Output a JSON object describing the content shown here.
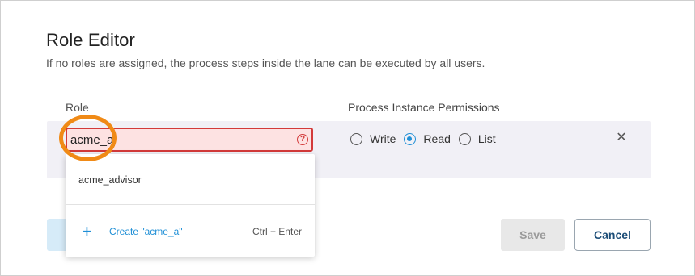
{
  "dialog": {
    "title": "Role Editor",
    "subtitle": "If no roles are assigned, the process steps inside the lane can be executed by all users."
  },
  "table": {
    "role_header": "Role",
    "permissions_header": "Process Instance Permissions"
  },
  "role_input": {
    "value": "acme_a",
    "error": true
  },
  "permissions": {
    "options": [
      {
        "label": "Write",
        "checked": false
      },
      {
        "label": "Read",
        "checked": true
      },
      {
        "label": "List",
        "checked": false
      }
    ]
  },
  "dropdown": {
    "suggestion": "acme_advisor",
    "create_label": "Create \"acme_a\"",
    "shortcut": "Ctrl + Enter"
  },
  "buttons": {
    "save": "Save",
    "cancel": "Cancel"
  },
  "icons": {
    "error": "error-icon",
    "remove": "close-icon",
    "create": "plus-icon"
  },
  "colors": {
    "accent": "#1f8fd6",
    "error": "#d33a3a",
    "highlight": "#f08a16"
  }
}
